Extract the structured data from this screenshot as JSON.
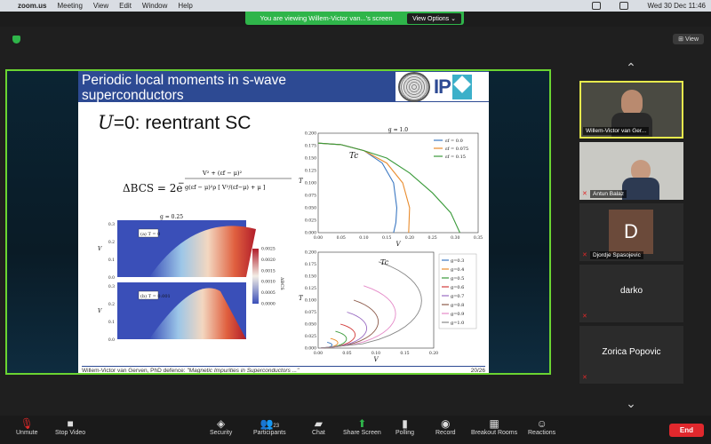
{
  "menubar": {
    "app": "zoom.us",
    "items": [
      "Meeting",
      "View",
      "Edit",
      "Window",
      "Help"
    ],
    "clock": "Wed 30 Dec  11:46"
  },
  "banner": {
    "message": "You are viewing Willem-Victor van...'s screen",
    "view_options": "View Options ⌄"
  },
  "window": {
    "view_label": "View"
  },
  "slide": {
    "title": "Periodic local moments in s-wave superconductors",
    "heading_prefix": "U",
    "heading_rest": "=0: reentrant SC",
    "formula_lhs": "ΔBCS = 2e",
    "footer_left": "Willem-Victor van Gerven, PhD defence: ",
    "footer_italic": "\"Magnetic Impurities in Superconductors ...\"",
    "page": "20/26"
  },
  "chart_data": [
    {
      "type": "line",
      "title": "g = 1.0",
      "xlabel": "V",
      "ylabel": "T",
      "annotation": "Tc",
      "xlim": [
        0,
        0.35
      ],
      "ylim": [
        0,
        0.2
      ],
      "xticks": [
        "0.00",
        "0.05",
        "0.10",
        "0.15",
        "0.20",
        "0.25",
        "0.30",
        "0.35"
      ],
      "yticks": [
        "0.000",
        "0.025",
        "0.050",
        "0.075",
        "0.100",
        "0.125",
        "0.150",
        "0.175",
        "0.200"
      ],
      "series": [
        {
          "name": "εf = 0.0",
          "color": "#3b78c2",
          "points": [
            [
              0,
              0.18
            ],
            [
              0.05,
              0.177
            ],
            [
              0.1,
              0.165
            ],
            [
              0.14,
              0.14
            ],
            [
              0.165,
              0.1
            ],
            [
              0.172,
              0.05
            ],
            [
              0.17,
              0.02
            ],
            [
              0.165,
              0.0
            ]
          ]
        },
        {
          "name": "εf = 0.075",
          "color": "#e98c2d",
          "points": [
            [
              0,
              0.18
            ],
            [
              0.05,
              0.177
            ],
            [
              0.1,
              0.165
            ],
            [
              0.15,
              0.14
            ],
            [
              0.185,
              0.1
            ],
            [
              0.2,
              0.05
            ],
            [
              0.198,
              0.0
            ]
          ]
        },
        {
          "name": "εf = 0.15",
          "color": "#3a9a3a",
          "points": [
            [
              0,
              0.18
            ],
            [
              0.05,
              0.177
            ],
            [
              0.1,
              0.165
            ],
            [
              0.15,
              0.15
            ],
            [
              0.2,
              0.12
            ],
            [
              0.25,
              0.08
            ],
            [
              0.29,
              0.04
            ],
            [
              0.31,
              0.0
            ]
          ]
        }
      ]
    },
    {
      "type": "line",
      "xlabel": "V",
      "ylabel": "T",
      "annotation": "Tc",
      "xlim": [
        0,
        0.2
      ],
      "ylim": [
        0,
        0.2
      ],
      "xticks": [
        "0.00",
        "0.05",
        "0.10",
        "0.15",
        "0.20"
      ],
      "yticks": [
        "0.000",
        "0.025",
        "0.050",
        "0.075",
        "0.100",
        "0.125",
        "0.150",
        "0.175",
        "0.200"
      ],
      "series": [
        {
          "name": "g=0.3",
          "color": "#3b78c2",
          "peak": 0.012,
          "vmax": 0.02
        },
        {
          "name": "g=0.4",
          "color": "#e98c2d",
          "peak": 0.02,
          "vmax": 0.03
        },
        {
          "name": "g=0.5",
          "color": "#3a9a3a",
          "peak": 0.035,
          "vmax": 0.045
        },
        {
          "name": "g=0.6",
          "color": "#d23a3a",
          "peak": 0.05,
          "vmax": 0.06
        },
        {
          "name": "g=0.7",
          "color": "#9a6bc2",
          "peak": 0.075,
          "vmax": 0.08
        },
        {
          "name": "g=0.8",
          "color": "#8c5a4a",
          "peak": 0.1,
          "vmax": 0.1
        },
        {
          "name": "g=0.9",
          "color": "#e58ac8",
          "peak": 0.13,
          "vmax": 0.13
        },
        {
          "name": "g=1.0",
          "color": "#888888",
          "peak": 0.18,
          "vmax": 0.175
        }
      ]
    },
    {
      "type": "heatmap",
      "title": "g = 0.25",
      "panels": [
        "(a) T = 0",
        "(b) T = 0.001"
      ],
      "ylabel": "V",
      "yticks": [
        "0.0",
        "0.1",
        "0.2",
        "0.3"
      ],
      "colorbar_label": "ΔBCS",
      "colorbar_ticks": [
        "0.0000",
        "0.0005",
        "0.0010",
        "0.0015",
        "0.0020",
        "0.0025"
      ]
    }
  ],
  "participants": [
    {
      "name": "Willem-Victor van Ger...",
      "active": true
    },
    {
      "name": "Antun Balaz",
      "muted": true
    },
    {
      "name": "Djordje Spasojevic",
      "initial": "D",
      "muted": true
    },
    {
      "name": "darko",
      "muted": true
    },
    {
      "name": "Zorica Popovic",
      "muted": true
    }
  ],
  "toolbar": {
    "unmute": "Unmute",
    "stop_video": "Stop Video",
    "security": "Security",
    "participants": "Participants",
    "participants_count": "23",
    "chat": "Chat",
    "share_screen": "Share Screen",
    "polling": "Polling",
    "record": "Record",
    "breakout": "Breakout Rooms",
    "reactions": "Reactions",
    "end": "End"
  }
}
